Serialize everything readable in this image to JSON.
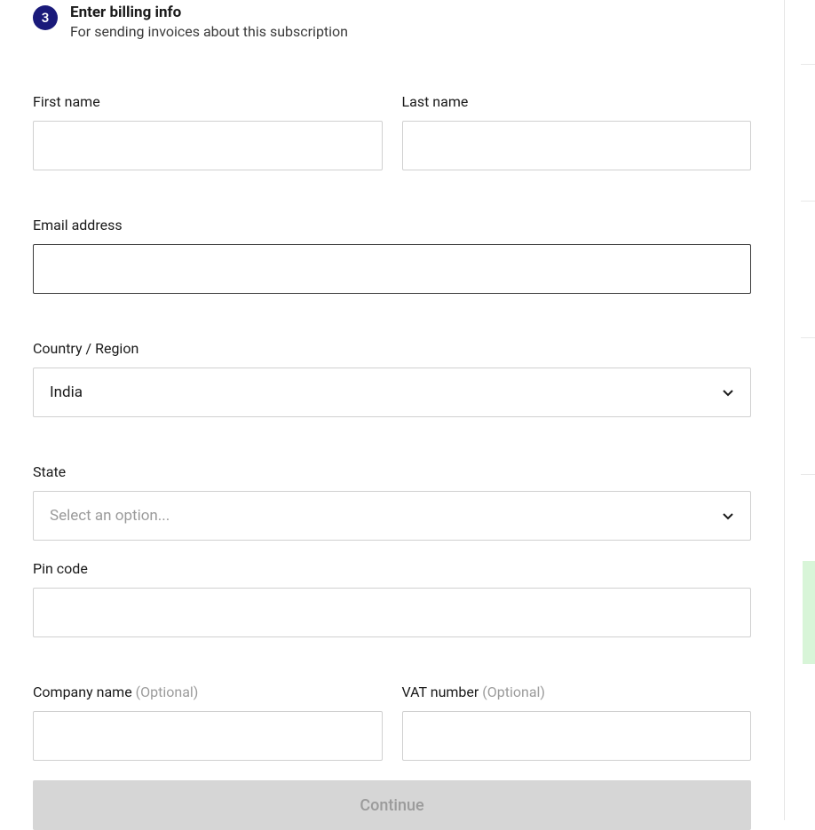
{
  "step": {
    "number": "3",
    "title": "Enter billing info",
    "subtitle": "For sending invoices about this subscription"
  },
  "form": {
    "first_name": {
      "label": "First name",
      "value": ""
    },
    "last_name": {
      "label": "Last name",
      "value": ""
    },
    "email": {
      "label": "Email address",
      "value": ""
    },
    "country": {
      "label": "Country / Region",
      "value": "India"
    },
    "state": {
      "label": "State",
      "placeholder": "Select an option..."
    },
    "pin_code": {
      "label": "Pin code",
      "value": ""
    },
    "company_name": {
      "label": "Company name ",
      "optional": "(Optional)",
      "value": ""
    },
    "vat_number": {
      "label": "VAT number ",
      "optional": "(Optional)",
      "value": ""
    }
  },
  "actions": {
    "continue_label": "Continue"
  }
}
